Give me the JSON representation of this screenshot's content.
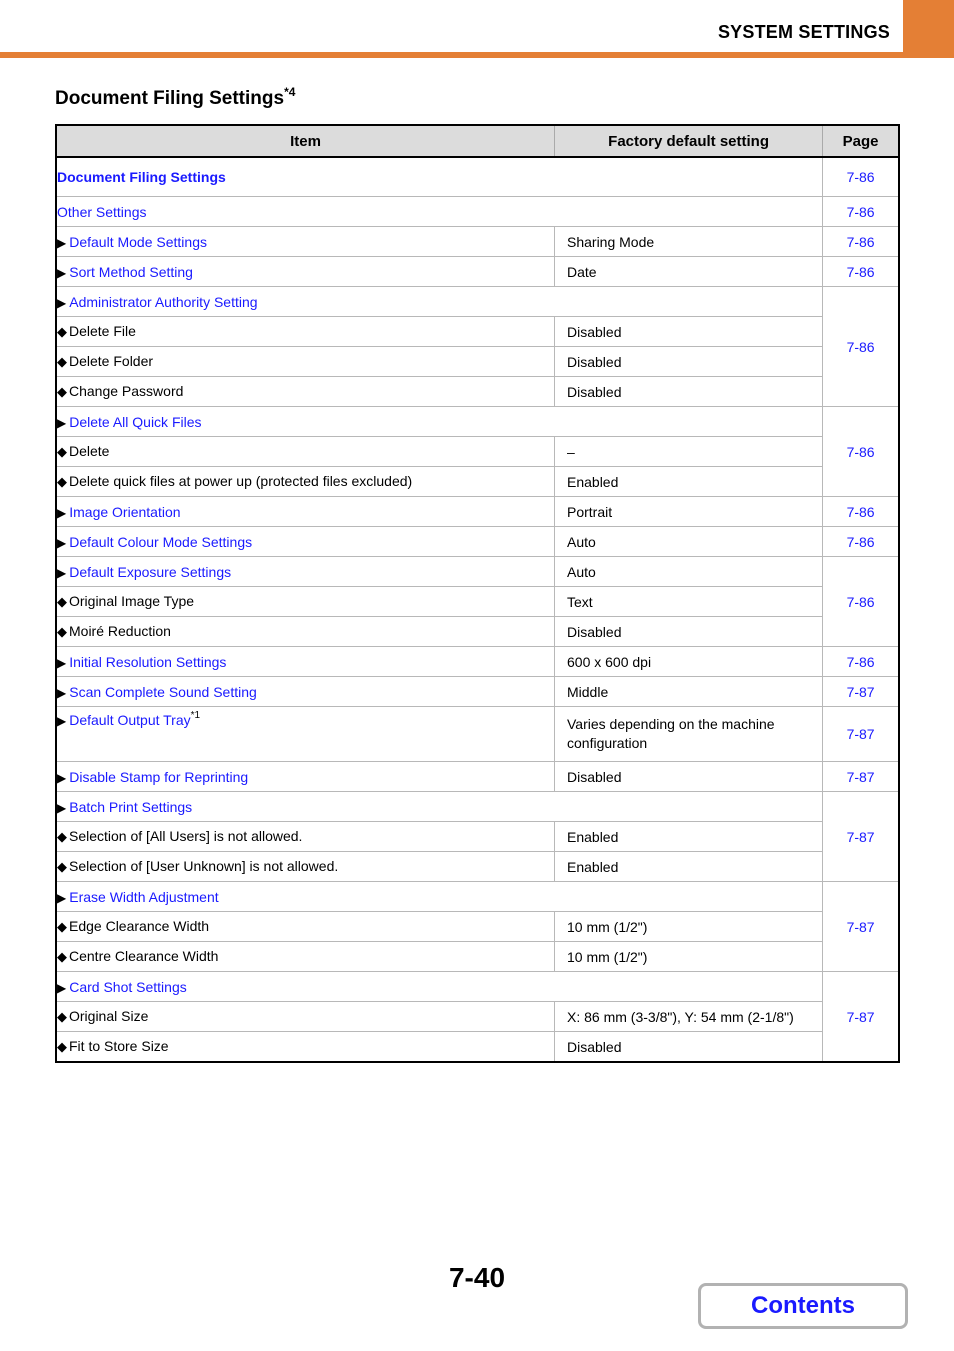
{
  "header": {
    "section": "SYSTEM SETTINGS",
    "accent_color": "#e47f35"
  },
  "title": {
    "text": "Document Filing Settings",
    "note": "*4"
  },
  "table": {
    "columns": [
      "Item",
      "Factory default setting",
      "Page"
    ],
    "rows": [
      {
        "item": "Document Filing Settings",
        "page": "7-86"
      },
      {
        "item": "Other Settings",
        "page": "7-86"
      },
      {
        "item": "Default Mode Settings",
        "value": "Sharing Mode",
        "page": "7-86"
      },
      {
        "item": "Sort Method Setting",
        "value": "Date",
        "page": "7-86"
      },
      {
        "item": "Administrator Authority Setting",
        "page": "7-86",
        "children": [
          {
            "item": "Delete File",
            "value": "Disabled"
          },
          {
            "item": "Delete Folder",
            "value": "Disabled"
          },
          {
            "item": "Change Password",
            "value": "Disabled"
          }
        ]
      },
      {
        "item": "Delete All Quick Files",
        "page": "7-86",
        "children": [
          {
            "item": "Delete",
            "value": "–"
          },
          {
            "item": "Delete quick files at power up (protected files excluded)",
            "value": "Enabled"
          }
        ]
      },
      {
        "item": "Image Orientation",
        "value": "Portrait",
        "page": "7-86"
      },
      {
        "item": "Default Colour Mode Settings",
        "value": "Auto",
        "page": "7-86"
      },
      {
        "item": "Default Exposure Settings",
        "value": "Auto",
        "page": "7-86",
        "children": [
          {
            "item": "Original Image Type",
            "value": "Text"
          },
          {
            "item": "Moiré Reduction",
            "value": "Disabled"
          }
        ]
      },
      {
        "item": "Initial Resolution Settings",
        "value": "600 x 600 dpi",
        "page": "7-86"
      },
      {
        "item": "Scan Complete Sound Setting",
        "value": "Middle",
        "page": "7-87"
      },
      {
        "item": "Default Output Tray",
        "note": "*1",
        "value": "Varies depending on the machine configuration",
        "page": "7-87"
      },
      {
        "item": "Disable Stamp for Reprinting",
        "value": "Disabled",
        "page": "7-87"
      },
      {
        "item": "Batch Print Settings",
        "page": "7-87",
        "children": [
          {
            "item": "Selection of [All Users] is not allowed.",
            "value": "Enabled"
          },
          {
            "item": "Selection of [User Unknown] is not allowed.",
            "value": "Enabled"
          }
        ]
      },
      {
        "item": "Erase Width Adjustment",
        "page": "7-87",
        "children": [
          {
            "item": "Edge Clearance Width",
            "value": "10 mm (1/2\")"
          },
          {
            "item": "Centre Clearance Width",
            "value": "10 mm (1/2\")"
          }
        ]
      },
      {
        "item": "Card Shot Settings",
        "page": "7-87",
        "children": [
          {
            "item": "Original Size",
            "value": "X: 86 mm (3-3/8\"), Y: 54 mm (2-1/8\")"
          },
          {
            "item": "Fit to Store Size",
            "value": "Disabled"
          }
        ]
      }
    ]
  },
  "footer": {
    "page_number": "7-40",
    "contents_label": "Contents"
  },
  "glyphs": {
    "triangle": "▶",
    "diamond": "◆"
  }
}
